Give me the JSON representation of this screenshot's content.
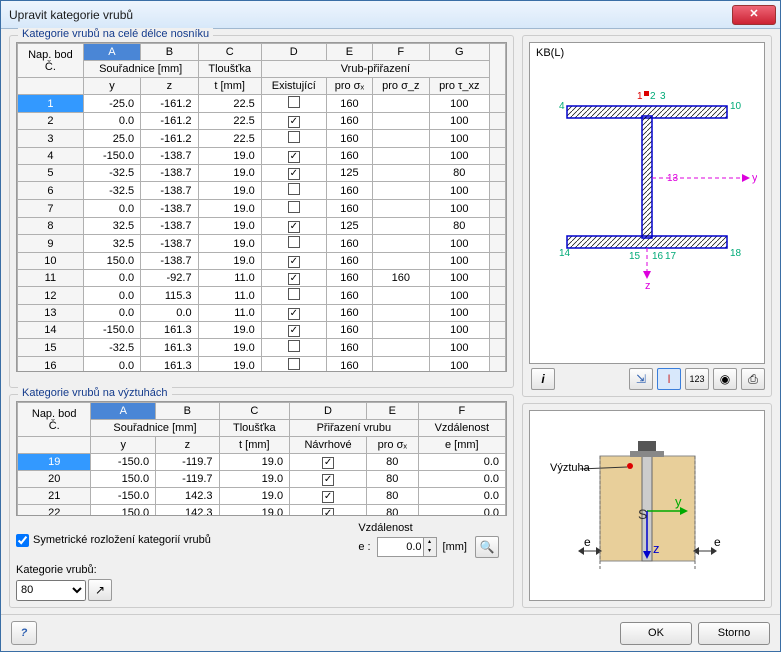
{
  "window": {
    "title": "Upravit kategorie vrubů"
  },
  "panel1": {
    "title": "Kategorie vrubů na celé délce nosníku",
    "cols": [
      "A",
      "B",
      "C",
      "D",
      "E",
      "F",
      "G"
    ],
    "h_nap": "Nap. bod",
    "h_c": "Č.",
    "h_sour": "Souřadnice [mm]",
    "h_y": "y",
    "h_z": "z",
    "h_tl": "Tloušťka",
    "h_tmm": "t [mm]",
    "h_vp": "Vrub-přiřazení",
    "h_ex": "Existující",
    "h_sx": "pro σₓ",
    "h_sz": "pro σ_z",
    "h_txz": "pro τ_xz",
    "rows": [
      {
        "n": 1,
        "y": "-25.0",
        "z": "-161.2",
        "t": "22.5",
        "ex": false,
        "sx": "160",
        "sz": "",
        "txz": "100",
        "sel": true
      },
      {
        "n": 2,
        "y": "0.0",
        "z": "-161.2",
        "t": "22.5",
        "ex": true,
        "sx": "160",
        "sz": "",
        "txz": "100"
      },
      {
        "n": 3,
        "y": "25.0",
        "z": "-161.2",
        "t": "22.5",
        "ex": false,
        "sx": "160",
        "sz": "",
        "txz": "100"
      },
      {
        "n": 4,
        "y": "-150.0",
        "z": "-138.7",
        "t": "19.0",
        "ex": true,
        "sx": "160",
        "sz": "",
        "txz": "100"
      },
      {
        "n": 5,
        "y": "-32.5",
        "z": "-138.7",
        "t": "19.0",
        "ex": true,
        "sx": "125",
        "sz": "",
        "txz": "80"
      },
      {
        "n": 6,
        "y": "-32.5",
        "z": "-138.7",
        "t": "19.0",
        "ex": false,
        "sx": "160",
        "sz": "",
        "txz": "100"
      },
      {
        "n": 7,
        "y": "0.0",
        "z": "-138.7",
        "t": "19.0",
        "ex": false,
        "sx": "160",
        "sz": "",
        "txz": "100"
      },
      {
        "n": 8,
        "y": "32.5",
        "z": "-138.7",
        "t": "19.0",
        "ex": true,
        "sx": "125",
        "sz": "",
        "txz": "80"
      },
      {
        "n": 9,
        "y": "32.5",
        "z": "-138.7",
        "t": "19.0",
        "ex": false,
        "sx": "160",
        "sz": "",
        "txz": "100"
      },
      {
        "n": 10,
        "y": "150.0",
        "z": "-138.7",
        "t": "19.0",
        "ex": true,
        "sx": "160",
        "sz": "",
        "txz": "100"
      },
      {
        "n": 11,
        "y": "0.0",
        "z": "-92.7",
        "t": "11.0",
        "ex": true,
        "sx": "160",
        "sz": "160",
        "txz": "100"
      },
      {
        "n": 12,
        "y": "0.0",
        "z": "115.3",
        "t": "11.0",
        "ex": false,
        "sx": "160",
        "sz": "",
        "txz": "100"
      },
      {
        "n": 13,
        "y": "0.0",
        "z": "0.0",
        "t": "11.0",
        "ex": true,
        "sx": "160",
        "sz": "",
        "txz": "100"
      },
      {
        "n": 14,
        "y": "-150.0",
        "z": "161.3",
        "t": "19.0",
        "ex": true,
        "sx": "160",
        "sz": "",
        "txz": "100"
      },
      {
        "n": 15,
        "y": "-32.5",
        "z": "161.3",
        "t": "19.0",
        "ex": false,
        "sx": "160",
        "sz": "",
        "txz": "100"
      },
      {
        "n": 16,
        "y": "0.0",
        "z": "161.3",
        "t": "19.0",
        "ex": false,
        "sx": "160",
        "sz": "",
        "txz": "100"
      }
    ]
  },
  "panel2": {
    "title": "Kategorie vrubů na výztuhách",
    "cols": [
      "A",
      "B",
      "C",
      "D",
      "E",
      "F"
    ],
    "h_pv": "Přiřazení vrubu",
    "h_nav": "Návrhové",
    "h_vzd": "Vzdálenost",
    "h_emm": "e [mm]",
    "rows": [
      {
        "n": 19,
        "y": "-150.0",
        "z": "-119.7",
        "t": "19.0",
        "nav": true,
        "sx": "80",
        "e": "0.0",
        "sel": true
      },
      {
        "n": 20,
        "y": "150.0",
        "z": "-119.7",
        "t": "19.0",
        "nav": true,
        "sx": "80",
        "e": "0.0"
      },
      {
        "n": 21,
        "y": "-150.0",
        "z": "142.3",
        "t": "19.0",
        "nav": true,
        "sx": "80",
        "e": "0.0"
      },
      {
        "n": 22,
        "y": "150.0",
        "z": "142.3",
        "t": "19.0",
        "nav": true,
        "sx": "80",
        "e": "0.0"
      }
    ]
  },
  "sym_label": "Symetrické rozložení kategorií vrubů",
  "sym_checked": true,
  "dist_label": "Vzdálenost",
  "dist_e": "e :",
  "dist_val": "0.0",
  "dist_unit": "[mm]",
  "cat_label": "Kategorie vrubů:",
  "cat_value": "80",
  "preview_label": "KB(L)",
  "diagram2_label": "Výztuha",
  "btn_ok": "OK",
  "btn_cancel": "Storno"
}
